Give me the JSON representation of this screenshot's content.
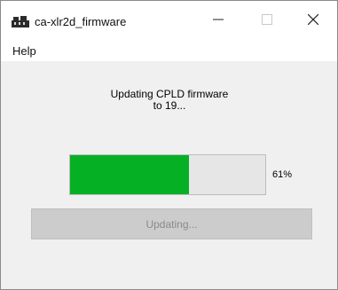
{
  "window": {
    "title": "ca-xlr2d_firmware",
    "app_icon": "app-icon"
  },
  "titlebar_buttons": {
    "minimize_icon": "minimize-icon",
    "maximize_icon": "maximize-icon",
    "close_icon": "close-icon"
  },
  "menu": {
    "help": "Help"
  },
  "status": {
    "line1": "Updating CPLD firmware",
    "line2": "to 19..."
  },
  "progress": {
    "value": 0.61,
    "label": "61%",
    "fill_color": "#06b025"
  },
  "button": {
    "label": "Updating...",
    "enabled": false
  }
}
